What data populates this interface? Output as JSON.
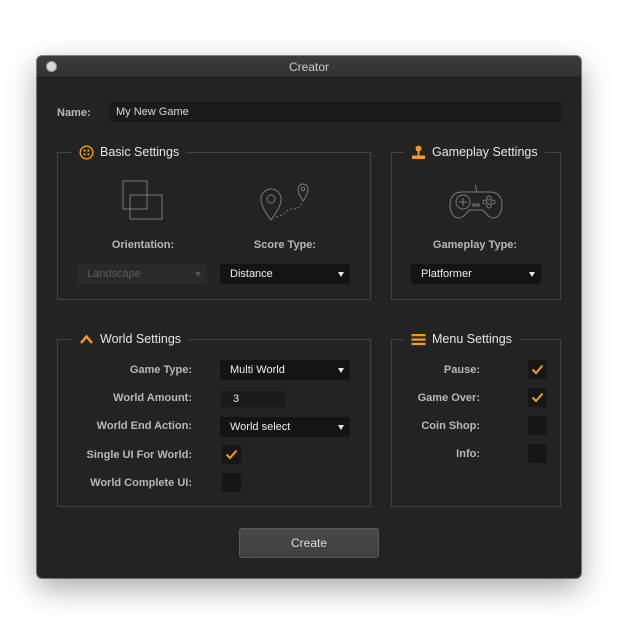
{
  "window": {
    "title": "Creator"
  },
  "name": {
    "label": "Name:",
    "value": "My New Game"
  },
  "basic_settings": {
    "title": "Basic Settings",
    "orientation_label": "Orientation:",
    "orientation_value": "Landscape",
    "score_type_label": "Score Type:",
    "score_type_value": "Distance"
  },
  "gameplay_settings": {
    "title": "Gameplay Settings",
    "gameplay_type_label": "Gameplay Type:",
    "gameplay_type_value": "Platformer"
  },
  "world_settings": {
    "title": "World Settings",
    "game_type_label": "Game Type:",
    "game_type_value": "Multi World",
    "world_amount_label": "World Amount:",
    "world_amount_value": "3",
    "world_end_action_label": "World End Action:",
    "world_end_action_value": "World select",
    "single_ui_label": "Single UI For World:",
    "single_ui_checked": true,
    "world_complete_ui_label": "World Complete UI:",
    "world_complete_ui_checked": false
  },
  "menu_settings": {
    "title": "Menu Settings",
    "pause_label": "Pause:",
    "pause_checked": true,
    "game_over_label": "Game Over:",
    "game_over_checked": true,
    "coin_shop_label": "Coin Shop:",
    "coin_shop_checked": false,
    "info_label": "Info:",
    "info_checked": false
  },
  "create_button": {
    "label": "Create"
  },
  "colors": {
    "accent": "#f39c1f",
    "background": "#232323",
    "field": "#141414"
  },
  "icons": {
    "basic": "four-dots-circle-icon",
    "gameplay": "joystick-icon",
    "world": "chevron-up-icon",
    "menu": "hamburger-icon",
    "orientation": "overlapping-squares-icon",
    "score": "location-route-icon",
    "gamepad": "gamepad-icon"
  }
}
